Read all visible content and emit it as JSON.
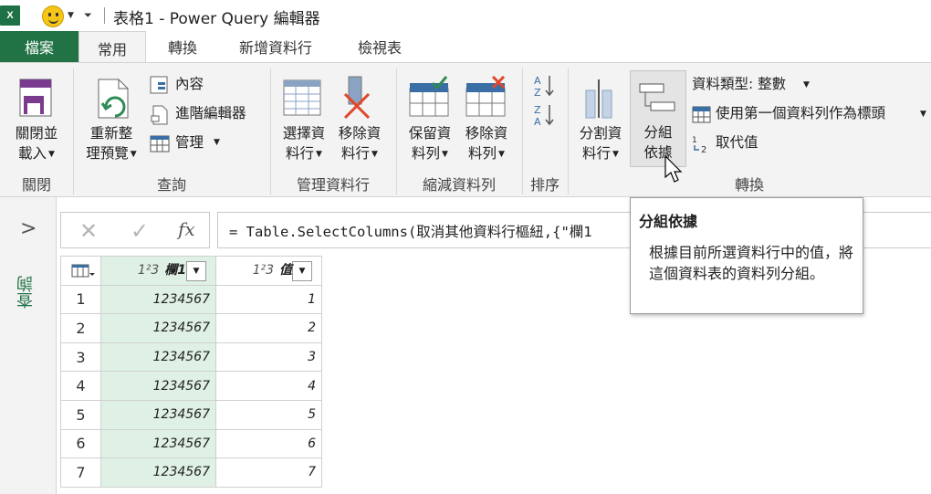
{
  "titlebar": {
    "app_icon_text": "X",
    "title": "表格1 - Power Query 編輯器"
  },
  "tabs": {
    "file": "檔案",
    "items": [
      "常用",
      "轉換",
      "新增資料行",
      "檢視表"
    ]
  },
  "ribbon": {
    "close_load": {
      "line1": "關閉並",
      "line2": "載入"
    },
    "refresh_preview": {
      "line1": "重新整",
      "line2": "理預覽"
    },
    "properties": "內容",
    "advanced_editor": "進階編輯器",
    "manage": "管理",
    "choose_columns": {
      "line1": "選擇資",
      "line2": "料行"
    },
    "remove_columns": {
      "line1": "移除資",
      "line2": "料行"
    },
    "keep_rows": {
      "line1": "保留資",
      "line2": "料列"
    },
    "remove_rows": {
      "line1": "移除資",
      "line2": "料列"
    },
    "split_column": {
      "line1": "分割資",
      "line2": "料行"
    },
    "group_by": {
      "line1": "分組",
      "line2": "依據"
    },
    "data_type": "資料類型: 整數",
    "use_first_row": "使用第一個資料列作為標頭",
    "replace_values": "取代值",
    "groups": {
      "close": "關閉",
      "query": "查詢",
      "manage_columns": "管理資料行",
      "reduce_rows": "縮減資料列",
      "sort": "排序",
      "transform": "轉換"
    }
  },
  "side_panel": {
    "label": "查詢"
  },
  "formula_bar": {
    "fx": "fx",
    "formula": "= Table.SelectColumns(取消其他資料行樞紐,{\"欄1"
  },
  "grid": {
    "columns": [
      {
        "type": "1²3",
        "name": "欄1"
      },
      {
        "type": "1²3",
        "name": "值"
      }
    ],
    "rows": [
      {
        "num": "1",
        "c1": "1234567",
        "c2": "1"
      },
      {
        "num": "2",
        "c1": "1234567",
        "c2": "2"
      },
      {
        "num": "3",
        "c1": "1234567",
        "c2": "3"
      },
      {
        "num": "4",
        "c1": "1234567",
        "c2": "4"
      },
      {
        "num": "5",
        "c1": "1234567",
        "c2": "5"
      },
      {
        "num": "6",
        "c1": "1234567",
        "c2": "6"
      },
      {
        "num": "7",
        "c1": "1234567",
        "c2": "7"
      }
    ]
  },
  "tooltip": {
    "title": "分組依據",
    "body": "根據目前所選資料行中的值，將這個資料表的資料列分組。"
  },
  "colors": {
    "excel_green": "#217346",
    "selected_column": "#dff0e5",
    "ribbon_bg": "#f3f3f3"
  }
}
